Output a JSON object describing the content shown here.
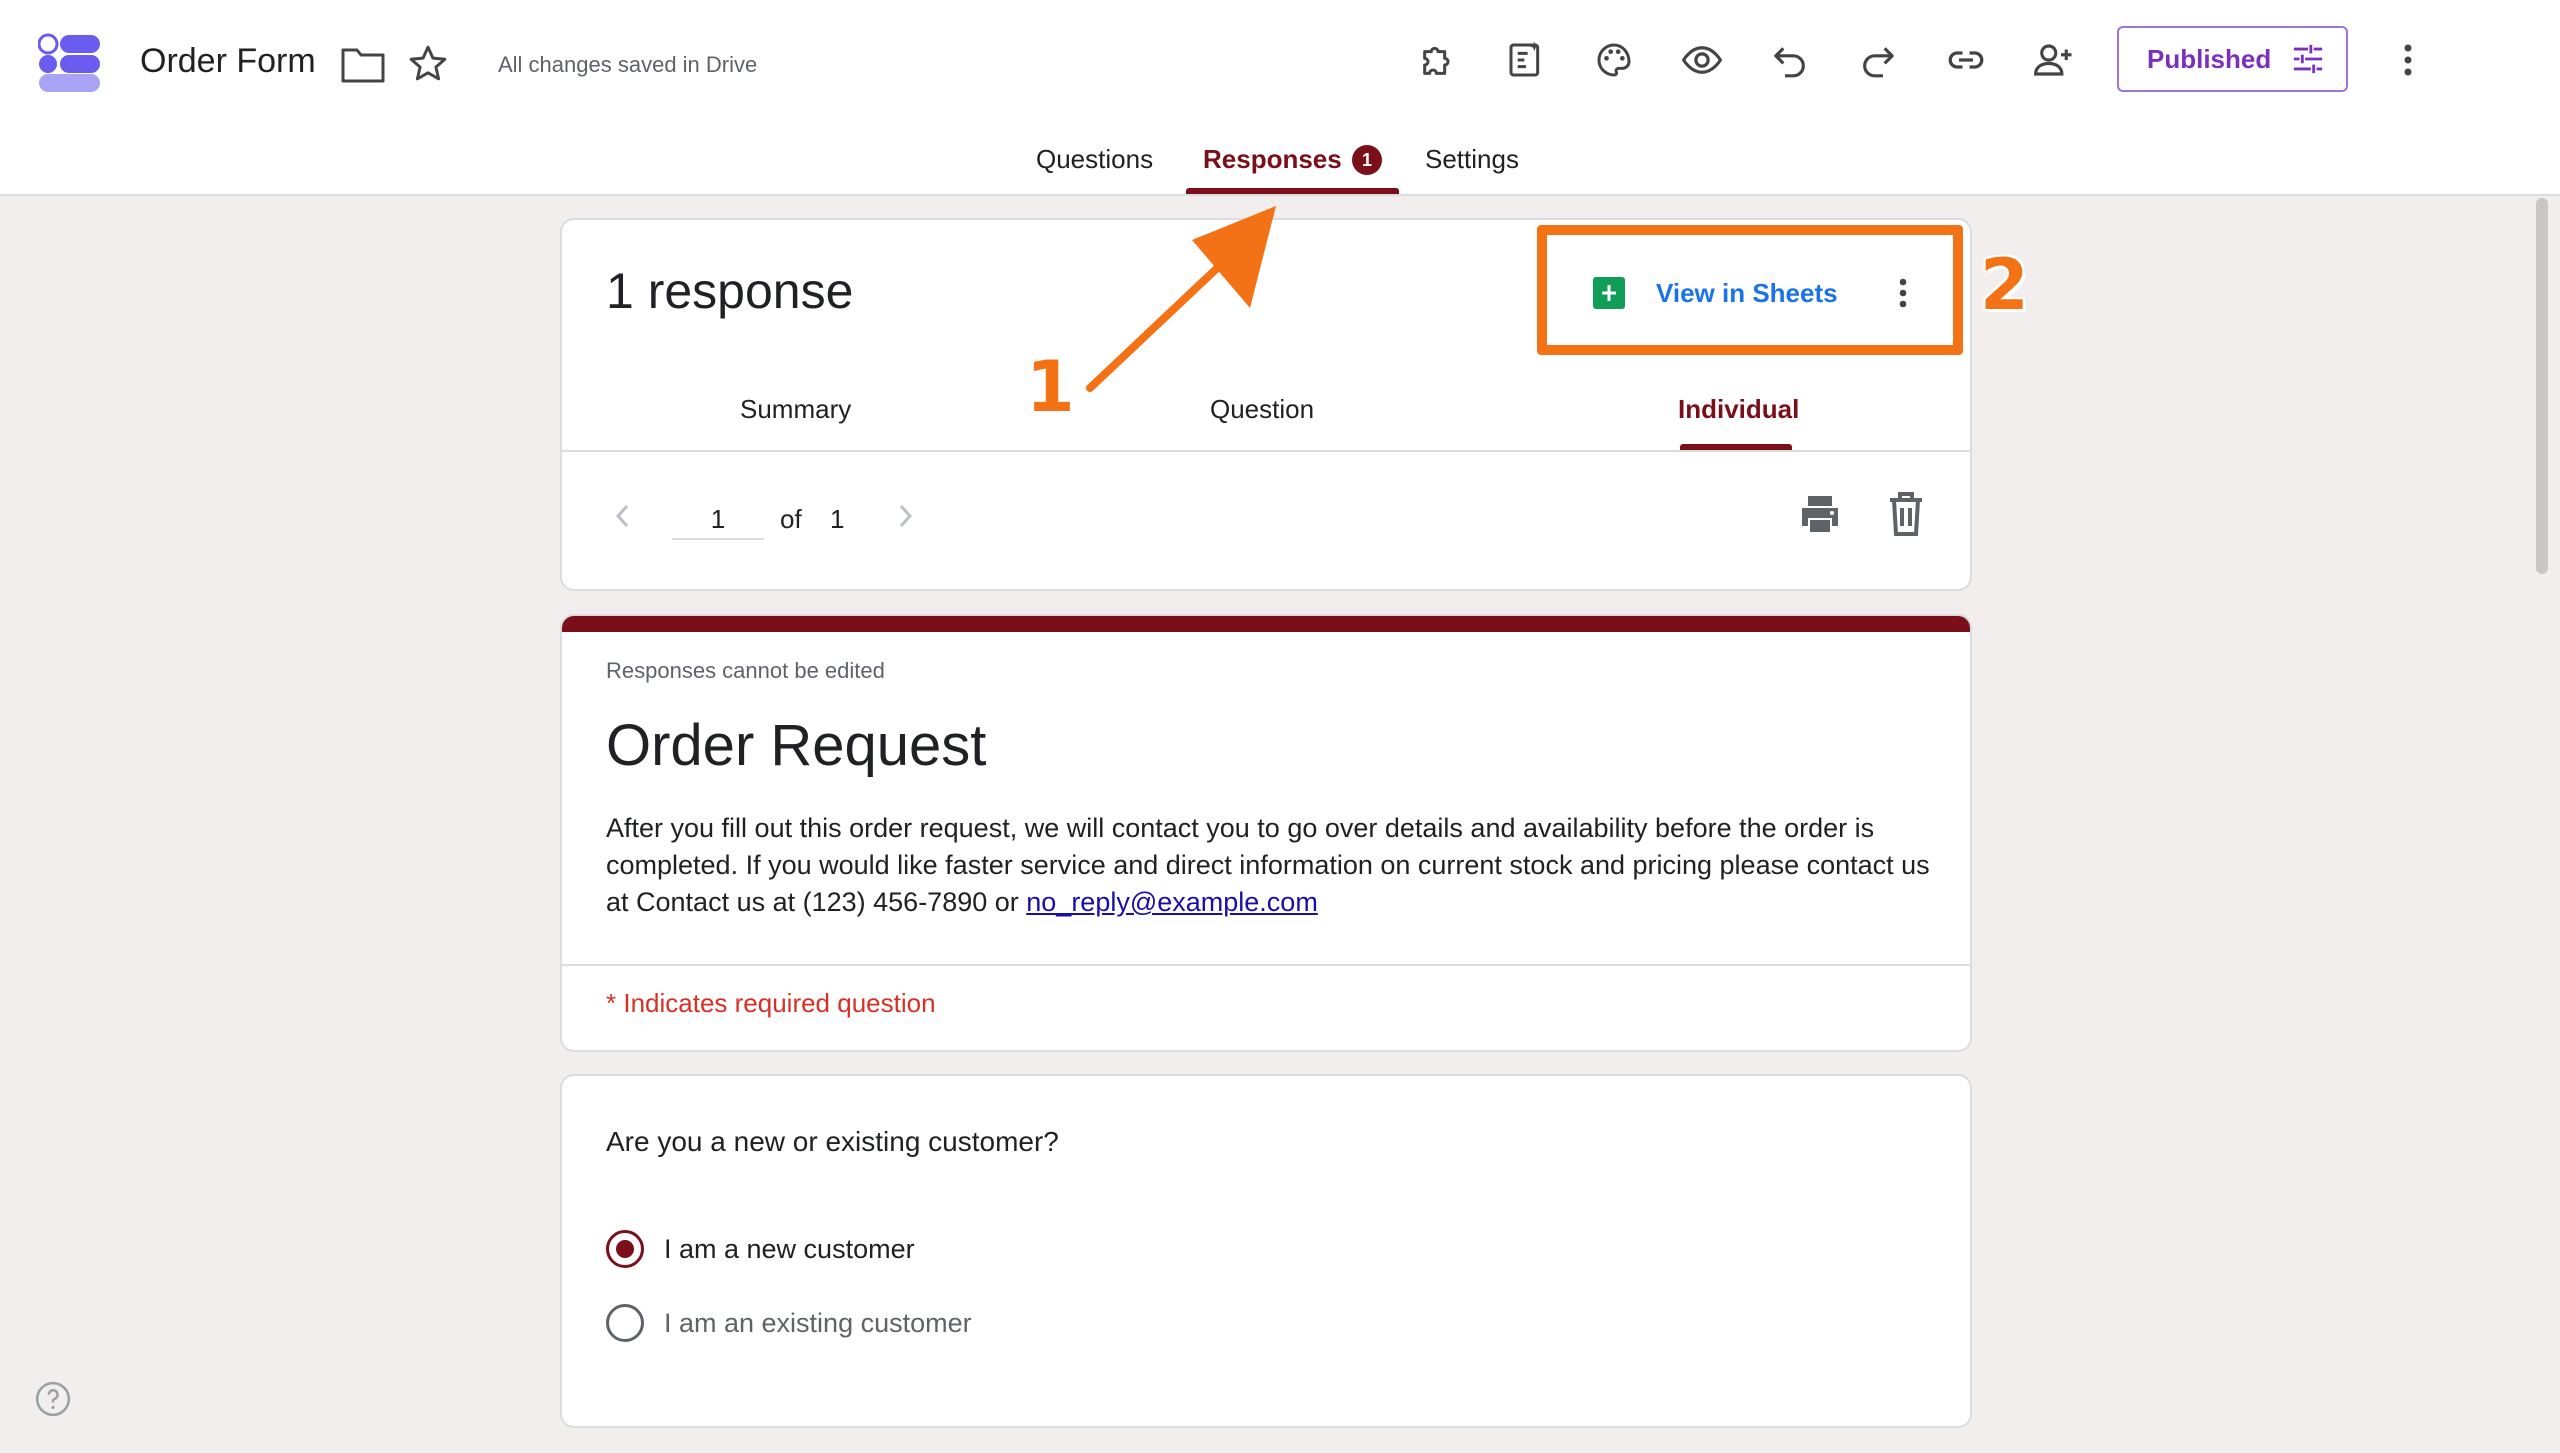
{
  "app": {
    "title": "Order Form",
    "save_status": "All changes saved in Drive",
    "published_label": "Published",
    "icons": [
      "add-ons-icon",
      "customize-theme-icon",
      "palette-icon",
      "preview-icon",
      "undo-icon",
      "redo-icon",
      "link-icon",
      "add-collaborator-icon",
      "more-vert-icon"
    ]
  },
  "tabs": [
    {
      "label": "Questions"
    },
    {
      "label": "Responses",
      "badge": "1",
      "active": true
    },
    {
      "label": "Settings"
    }
  ],
  "responses": {
    "count_label": "1 response",
    "view_sheets_label": "View in Sheets",
    "subtabs": [
      {
        "label": "Summary"
      },
      {
        "label": "Question"
      },
      {
        "label": "Individual",
        "active": true
      }
    ],
    "pager": {
      "current": "1",
      "of_label": "of",
      "total": "1"
    }
  },
  "form": {
    "notice": "Responses cannot be edited",
    "title": "Order Request",
    "description": "After you fill out this order request, we will contact you to go over details and availability before the order is completed. If you would like faster service and direct information on current stock and pricing please contact us at Contact us at (123) 456-7890 or ",
    "email": "no_reply@example.com",
    "required_note": "* Indicates required question"
  },
  "question": {
    "title": "Are you a new or existing customer?",
    "options": [
      {
        "label": "I am a new customer",
        "selected": true
      },
      {
        "label": "I am an existing customer",
        "selected": false
      }
    ]
  },
  "annotations": {
    "step1": "1",
    "step2": "2"
  },
  "colors": {
    "accent": "#7a0f1a",
    "callout": "#f47216",
    "link": "#1a73e8",
    "published": "#7b2fbf",
    "sheets_green": "#0f9d58"
  }
}
